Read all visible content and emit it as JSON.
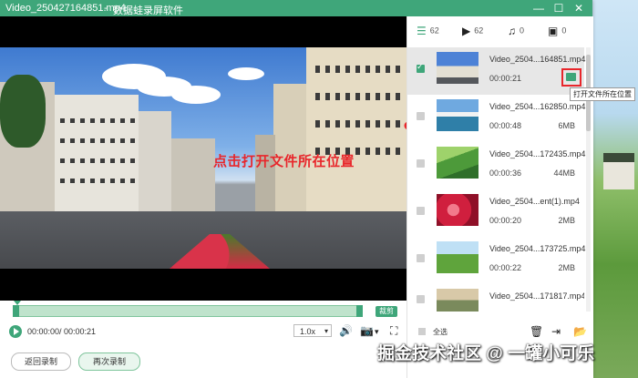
{
  "window": {
    "file_title": "Video_250427164851.mp4",
    "separator": "-",
    "app_title": "数据蛙录屏软件",
    "controls": [
      "minimize-icon",
      "maximize-icon",
      "close-icon"
    ]
  },
  "player": {
    "annotation": "点击打开文件所在位置",
    "trim_label": "裁剪",
    "time": "00:00:00/ 00:00:21",
    "speed": "1.0x",
    "icons": [
      "play-icon",
      "volume-icon",
      "camera-icon",
      "fullscreen-icon"
    ]
  },
  "actions": {
    "back_label": "返回录制",
    "again_label": "再次录制"
  },
  "tabs": [
    {
      "icon": "list-icon",
      "count": "62"
    },
    {
      "icon": "video-icon",
      "count": "62"
    },
    {
      "icon": "music-icon",
      "count": "0"
    },
    {
      "icon": "image-icon",
      "count": "0"
    }
  ],
  "files": [
    {
      "name": "Video_2504...164851.mp4",
      "duration": "00:00:21",
      "size": "",
      "selected": true
    },
    {
      "name": "Video_2504...162850.mp4",
      "duration": "00:00:48",
      "size": "6MB",
      "selected": false
    },
    {
      "name": "Video_2504...172435.mp4",
      "duration": "00:00:36",
      "size": "44MB",
      "selected": false
    },
    {
      "name": "Video_2504...ent(1).mp4",
      "duration": "00:00:20",
      "size": "2MB",
      "selected": false
    },
    {
      "name": "Video_2504...173725.mp4",
      "duration": "00:00:22",
      "size": "2MB",
      "selected": false
    },
    {
      "name": "Video_2504...171817.mp4",
      "duration": "",
      "size": "",
      "selected": false
    }
  ],
  "tooltip": "打开文件所在位置",
  "footer": {
    "select_all": "全选",
    "icons": [
      "trash-icon",
      "export-icon",
      "folder-icon"
    ]
  },
  "watermark": "掘金技术社区 @ 一罐小可乐",
  "colors": {
    "accent": "#3fa67a",
    "annotation": "#e8262b"
  }
}
